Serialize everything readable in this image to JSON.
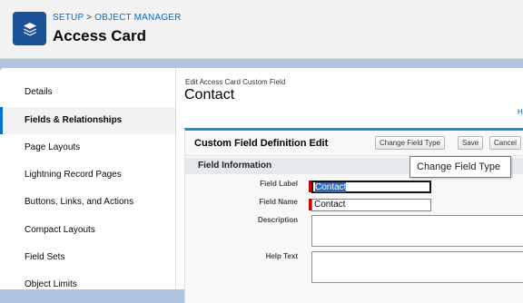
{
  "header": {
    "breadcrumb_setup": "SETUP",
    "breadcrumb_separator": ">",
    "breadcrumb_object_manager": "OBJECT MANAGER",
    "title": "Access Card",
    "icon": "layers-icon",
    "icon_color": "#1b5297"
  },
  "sidebar": {
    "items": [
      {
        "label": "Details"
      },
      {
        "label": "Fields & Relationships",
        "active": true
      },
      {
        "label": "Page Layouts"
      },
      {
        "label": "Lightning Record Pages"
      },
      {
        "label": "Buttons, Links, and Actions"
      },
      {
        "label": "Compact Layouts"
      },
      {
        "label": "Field Sets"
      },
      {
        "label": "Object Limits"
      }
    ]
  },
  "main": {
    "caption": "Edit Access Card Custom Field",
    "title": "Contact",
    "help_link": "H",
    "block": {
      "title": "Custom Field Definition Edit",
      "buttons": {
        "change_field_type": "Change Field Type",
        "save": "Save",
        "cancel": "Cancel"
      },
      "section_title": "Field Information",
      "fields": {
        "field_label": {
          "label": "Field Label",
          "value": "Contact"
        },
        "field_name": {
          "label": "Field Name",
          "value": "Contact"
        },
        "description": {
          "label": "Description",
          "value": ""
        },
        "help_text": {
          "label": "Help Text",
          "value": ""
        }
      }
    }
  },
  "tooltip": {
    "text": "Change Field Type"
  },
  "colors": {
    "accent": "#0070d2",
    "block_border": "#1797c0",
    "required": "#cc0000",
    "background": "#b0c4df"
  }
}
